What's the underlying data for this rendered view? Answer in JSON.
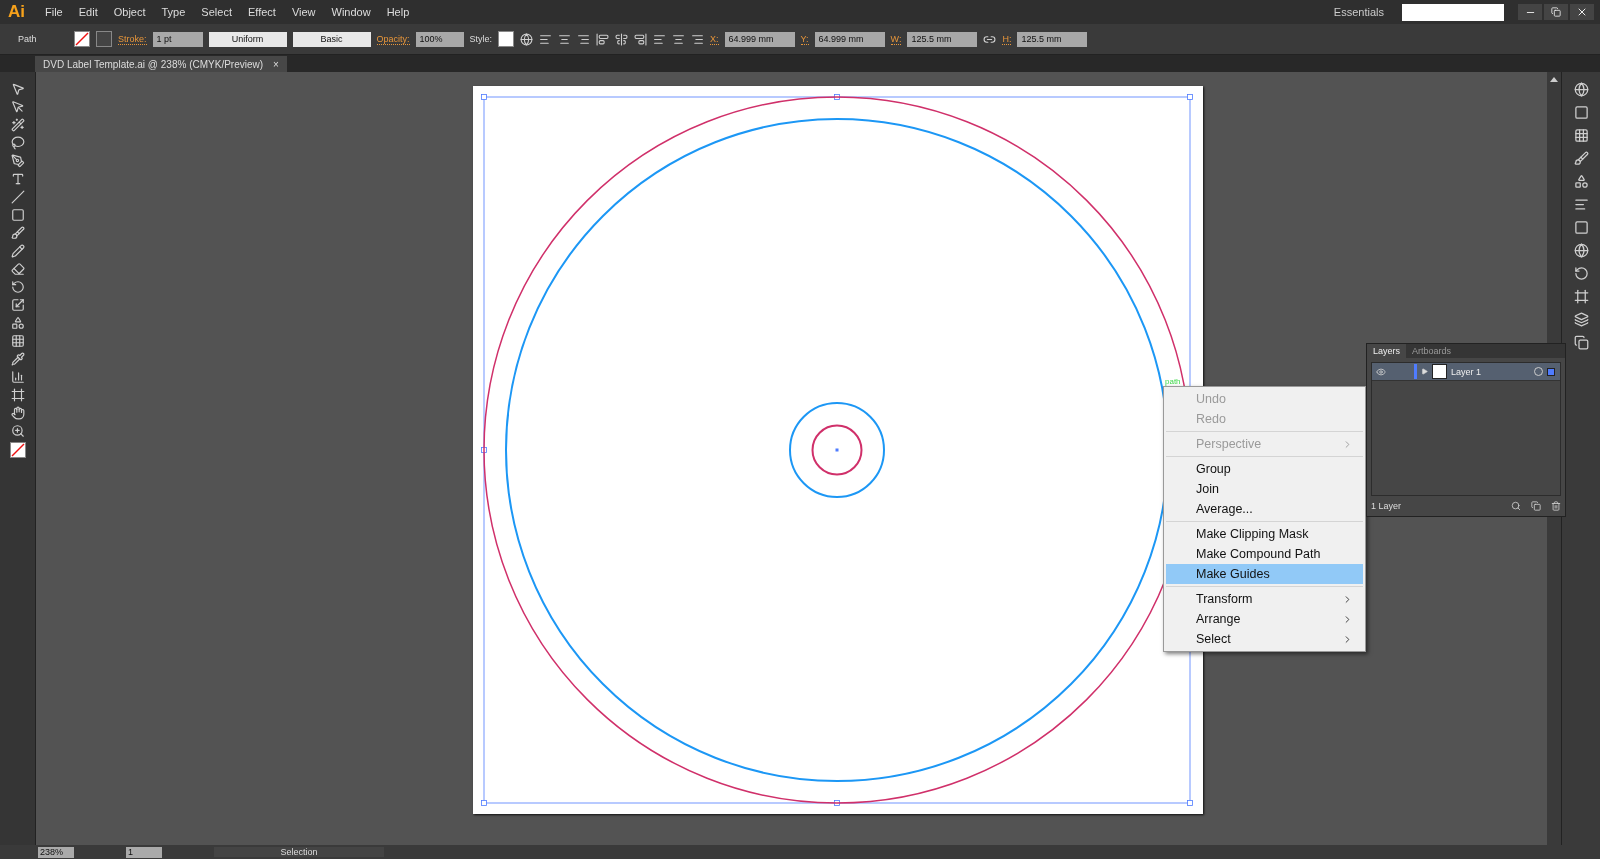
{
  "app_logo": "Ai",
  "menu": [
    "File",
    "Edit",
    "Object",
    "Type",
    "Select",
    "Effect",
    "View",
    "Window",
    "Help"
  ],
  "workspace": "Essentials",
  "control_bar": {
    "selection": "Path",
    "stroke_label": "Stroke:",
    "stroke_weight": "1 pt",
    "stroke_profile": "Uniform",
    "brush": "Basic",
    "opacity_label": "Opacity:",
    "opacity": "100%",
    "style_label": "Style:",
    "transform": [
      {
        "label": "X:",
        "value": "64.999 mm"
      },
      {
        "label": "Y:",
        "value": "64.999 mm"
      },
      {
        "label": "W:",
        "value": "125.5 mm"
      },
      {
        "label": "H:",
        "value": "125.5 mm"
      }
    ]
  },
  "document_tab": {
    "title": "DVD Label Template.ai @ 238% (CMYK/Preview)",
    "close": "×"
  },
  "canvas": {
    "hover_label": "path"
  },
  "context_menu": [
    [
      {
        "label": "Undo",
        "disabled": true,
        "submenu": false,
        "selected": false
      },
      {
        "label": "Redo",
        "disabled": true,
        "submenu": false,
        "selected": false
      }
    ],
    [
      {
        "label": "Perspective",
        "disabled": true,
        "submenu": true,
        "selected": false
      }
    ],
    [
      {
        "label": "Group",
        "disabled": false,
        "submenu": false,
        "selected": false
      },
      {
        "label": "Join",
        "disabled": false,
        "submenu": false,
        "selected": false
      },
      {
        "label": "Average...",
        "disabled": false,
        "submenu": false,
        "selected": false
      }
    ],
    [
      {
        "label": "Make Clipping Mask",
        "disabled": false,
        "submenu": false,
        "selected": false
      },
      {
        "label": "Make Compound Path",
        "disabled": false,
        "submenu": false,
        "selected": false
      },
      {
        "label": "Make Guides",
        "disabled": false,
        "submenu": false,
        "selected": true
      }
    ],
    [
      {
        "label": "Transform",
        "disabled": false,
        "submenu": true,
        "selected": false
      },
      {
        "label": "Arrange",
        "disabled": false,
        "submenu": true,
        "selected": false
      },
      {
        "label": "Select",
        "disabled": false,
        "submenu": true,
        "selected": false
      }
    ]
  ],
  "layers_panel": {
    "tabs": [
      {
        "label": "Layers",
        "selected": true
      },
      {
        "label": "Artboards",
        "selected": false
      }
    ],
    "layers": [
      {
        "name": "Layer 1",
        "visible": true,
        "color": "#4f7cff"
      }
    ],
    "footer": "1 Layer"
  },
  "status_bar": {
    "zoom": "238%",
    "artboard": "1",
    "tool": "Selection"
  }
}
